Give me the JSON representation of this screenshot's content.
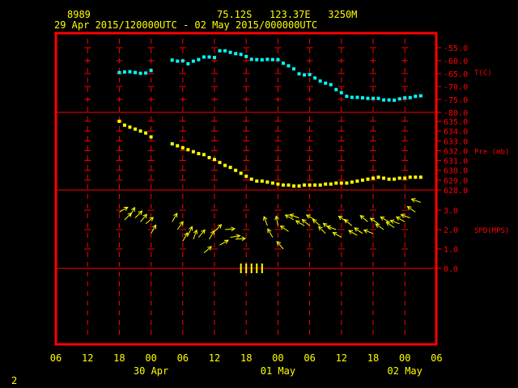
{
  "header": {
    "station_id": "8989",
    "location": "75.12S   123.37E   3250M",
    "time_range": "29 Apr 2015/120000UTC - 02 May 2015/000000UTC"
  },
  "footer": {
    "page_number": "2"
  },
  "colors": {
    "frame": "#ff0000",
    "text": "#ffff00",
    "temperature": "#00ffff",
    "pressure": "#ffff00",
    "wind": "#ffff00",
    "axis_labels": "#ff0000",
    "background": "#000000"
  },
  "chart_data": {
    "type": "scatter",
    "x_axis": {
      "ticks": [
        "06",
        "12",
        "18",
        "00",
        "06",
        "12",
        "18",
        "00",
        "06",
        "12",
        "18",
        "00",
        "06"
      ],
      "day_labels": [
        "30 Apr",
        "01 May",
        "02 May"
      ]
    },
    "panels": [
      {
        "name": "temperature",
        "axis_label": "T(C)",
        "ticks": [
          "-55.0",
          "-60.0",
          "-65.0",
          "-70.0",
          "-75.0",
          "-80.0"
        ],
        "ylim": [
          -80,
          -55
        ],
        "x_hours": [
          12,
          13,
          14,
          15,
          16,
          17,
          18,
          22,
          23,
          24,
          25,
          26,
          27,
          28,
          29,
          30,
          31,
          32,
          33,
          34,
          35,
          36,
          37,
          38,
          39,
          40,
          41,
          42,
          43,
          44,
          45,
          46,
          47,
          48,
          49,
          50,
          51,
          52,
          53,
          54,
          55,
          56,
          57,
          58,
          59,
          60,
          61,
          62,
          63,
          64,
          65,
          66,
          67,
          68,
          69
        ],
        "values": [
          -64.6,
          -64.4,
          -64.3,
          -64.6,
          -64.9,
          -64.8,
          -63.8,
          -59.8,
          -60.2,
          -60.1,
          -61.2,
          -60.2,
          -59.6,
          -58.6,
          -58.6,
          -58.8,
          -56.2,
          -56.2,
          -56.8,
          -57.3,
          -57.6,
          -58.4,
          -59.5,
          -59.6,
          -59.7,
          -59.5,
          -59.6,
          -59.6,
          -61.0,
          -62.0,
          -63.2,
          -65.1,
          -65.5,
          -65.4,
          -66.7,
          -67.9,
          -68.7,
          -69.3,
          -71.2,
          -72.4,
          -73.8,
          -74.2,
          -74.2,
          -74.4,
          -74.6,
          -74.6,
          -74.6,
          -75.2,
          -75.2,
          -75.3,
          -74.8,
          -74.4,
          -74.3,
          -73.8,
          -73.6
        ]
      },
      {
        "name": "pressure",
        "axis_label": "Pre (mb)",
        "ticks": [
          "635.0",
          "634.0",
          "633.0",
          "632.0",
          "631.0",
          "630.0",
          "629.0",
          "628.0"
        ],
        "ylim": [
          628,
          635
        ],
        "x_hours": [
          12,
          13,
          14,
          15,
          16,
          17,
          18,
          22,
          23,
          24,
          25,
          26,
          27,
          28,
          29,
          30,
          31,
          32,
          33,
          34,
          35,
          36,
          37,
          38,
          39,
          40,
          41,
          42,
          43,
          44,
          45,
          46,
          47,
          48,
          49,
          50,
          51,
          52,
          53,
          54,
          55,
          56,
          57,
          58,
          59,
          60,
          61,
          62,
          63,
          64,
          65,
          66,
          67,
          68,
          69
        ],
        "values": [
          635.0,
          634.6,
          634.4,
          634.2,
          634.0,
          633.8,
          633.4,
          632.7,
          632.5,
          632.3,
          632.1,
          631.9,
          631.7,
          631.6,
          631.3,
          631.1,
          630.8,
          630.5,
          630.3,
          630.0,
          629.7,
          629.4,
          629.1,
          628.9,
          628.9,
          628.8,
          628.7,
          628.6,
          628.5,
          628.5,
          628.4,
          628.4,
          628.5,
          628.5,
          628.5,
          628.5,
          628.6,
          628.6,
          628.7,
          628.7,
          628.7,
          628.8,
          628.9,
          629.0,
          629.1,
          629.2,
          629.3,
          629.2,
          629.1,
          629.1,
          629.2,
          629.2,
          629.3,
          629.3,
          629.3
        ]
      },
      {
        "name": "wind",
        "axis_label": "SPD(MPS)",
        "ticks": [
          "3.0",
          "2.0",
          "1.0",
          "0.0"
        ],
        "ylim": [
          0,
          3
        ],
        "x_hours": [
          12,
          13,
          14,
          15,
          16,
          17,
          18,
          22,
          23,
          24,
          25,
          26,
          27,
          28,
          29,
          30,
          31,
          32,
          33,
          34,
          35,
          36,
          37,
          38,
          39,
          40,
          41,
          42,
          43,
          44,
          45,
          46,
          47,
          48,
          49,
          50,
          51,
          52,
          53,
          54,
          55,
          56,
          57,
          58,
          59,
          60,
          61,
          62,
          63,
          64,
          65,
          66,
          67,
          68,
          69
        ],
        "values": [
          2.9,
          2.5,
          2.7,
          2.6,
          2.4,
          2.3,
          1.8,
          2.4,
          2.0,
          1.4,
          1.7,
          1.5,
          1.6,
          0.8,
          1.5,
          1.9,
          1.2,
          2.0,
          1.6,
          1.5,
          0.0,
          0.0,
          0.0,
          0.0,
          0.0,
          2.2,
          1.6,
          2.2,
          1.0,
          1.9,
          2.5,
          2.6,
          2.2,
          2.2,
          2.5,
          2.2,
          1.8,
          2.0,
          2.0,
          1.6,
          2.4,
          2.2,
          1.7,
          1.8,
          2.4,
          1.8,
          2.3,
          2.0,
          2.4,
          2.1,
          2.3,
          2.4,
          2.6,
          2.9,
          3.4
        ],
        "directions_deg": [
          330,
          315,
          300,
          315,
          310,
          320,
          300,
          300,
          305,
          300,
          295,
          290,
          310,
          320,
          300,
          315,
          330,
          355,
          350,
          355,
          90,
          90,
          90,
          90,
          90,
          250,
          240,
          260,
          230,
          215,
          210,
          200,
          210,
          220,
          210,
          220,
          225,
          220,
          200,
          210,
          215,
          220,
          210,
          215,
          220,
          200,
          215,
          215,
          210,
          215,
          200,
          210,
          200,
          215,
          200
        ]
      }
    ]
  }
}
